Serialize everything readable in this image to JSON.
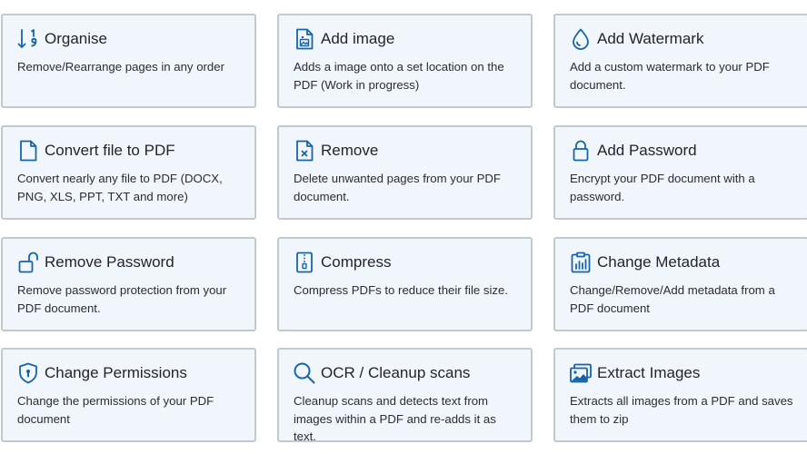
{
  "accent_color": "#1565a8",
  "cards": [
    {
      "title": "Organise",
      "description": "Remove/Rearrange pages in any order",
      "icon": "sort-numeric-down-icon"
    },
    {
      "title": "Add image",
      "description": "Adds a image onto a set location on the PDF (Work in progress)",
      "icon": "file-image-icon"
    },
    {
      "title": "Add Watermark",
      "description": "Add a custom watermark to your PDF document.",
      "icon": "droplet-icon"
    },
    {
      "title": "Convert file to PDF",
      "description": "Convert nearly any file to PDF (DOCX, PNG, XLS, PPT, TXT and more)",
      "icon": "file-icon"
    },
    {
      "title": "Remove",
      "description": "Delete unwanted pages from your PDF document.",
      "icon": "file-x-icon"
    },
    {
      "title": "Add Password",
      "description": "Encrypt your PDF document with a password.",
      "icon": "lock-icon"
    },
    {
      "title": "Remove Password",
      "description": "Remove password protection from your PDF document.",
      "icon": "unlock-icon"
    },
    {
      "title": "Compress",
      "description": "Compress PDFs to reduce their file size.",
      "icon": "file-zip-icon"
    },
    {
      "title": "Change Metadata",
      "description": "Change/Remove/Add metadata from a PDF document",
      "icon": "clipboard-data-icon"
    },
    {
      "title": "Change Permissions",
      "description": "Change the permissions of your PDF document",
      "icon": "shield-lock-icon"
    },
    {
      "title": "OCR / Cleanup scans",
      "description": "Cleanup scans and detects text from images within a PDF and re-adds it as text.",
      "icon": "search-icon"
    },
    {
      "title": "Extract Images",
      "description": "Extracts all images from a PDF and saves them to zip",
      "icon": "images-icon"
    }
  ]
}
